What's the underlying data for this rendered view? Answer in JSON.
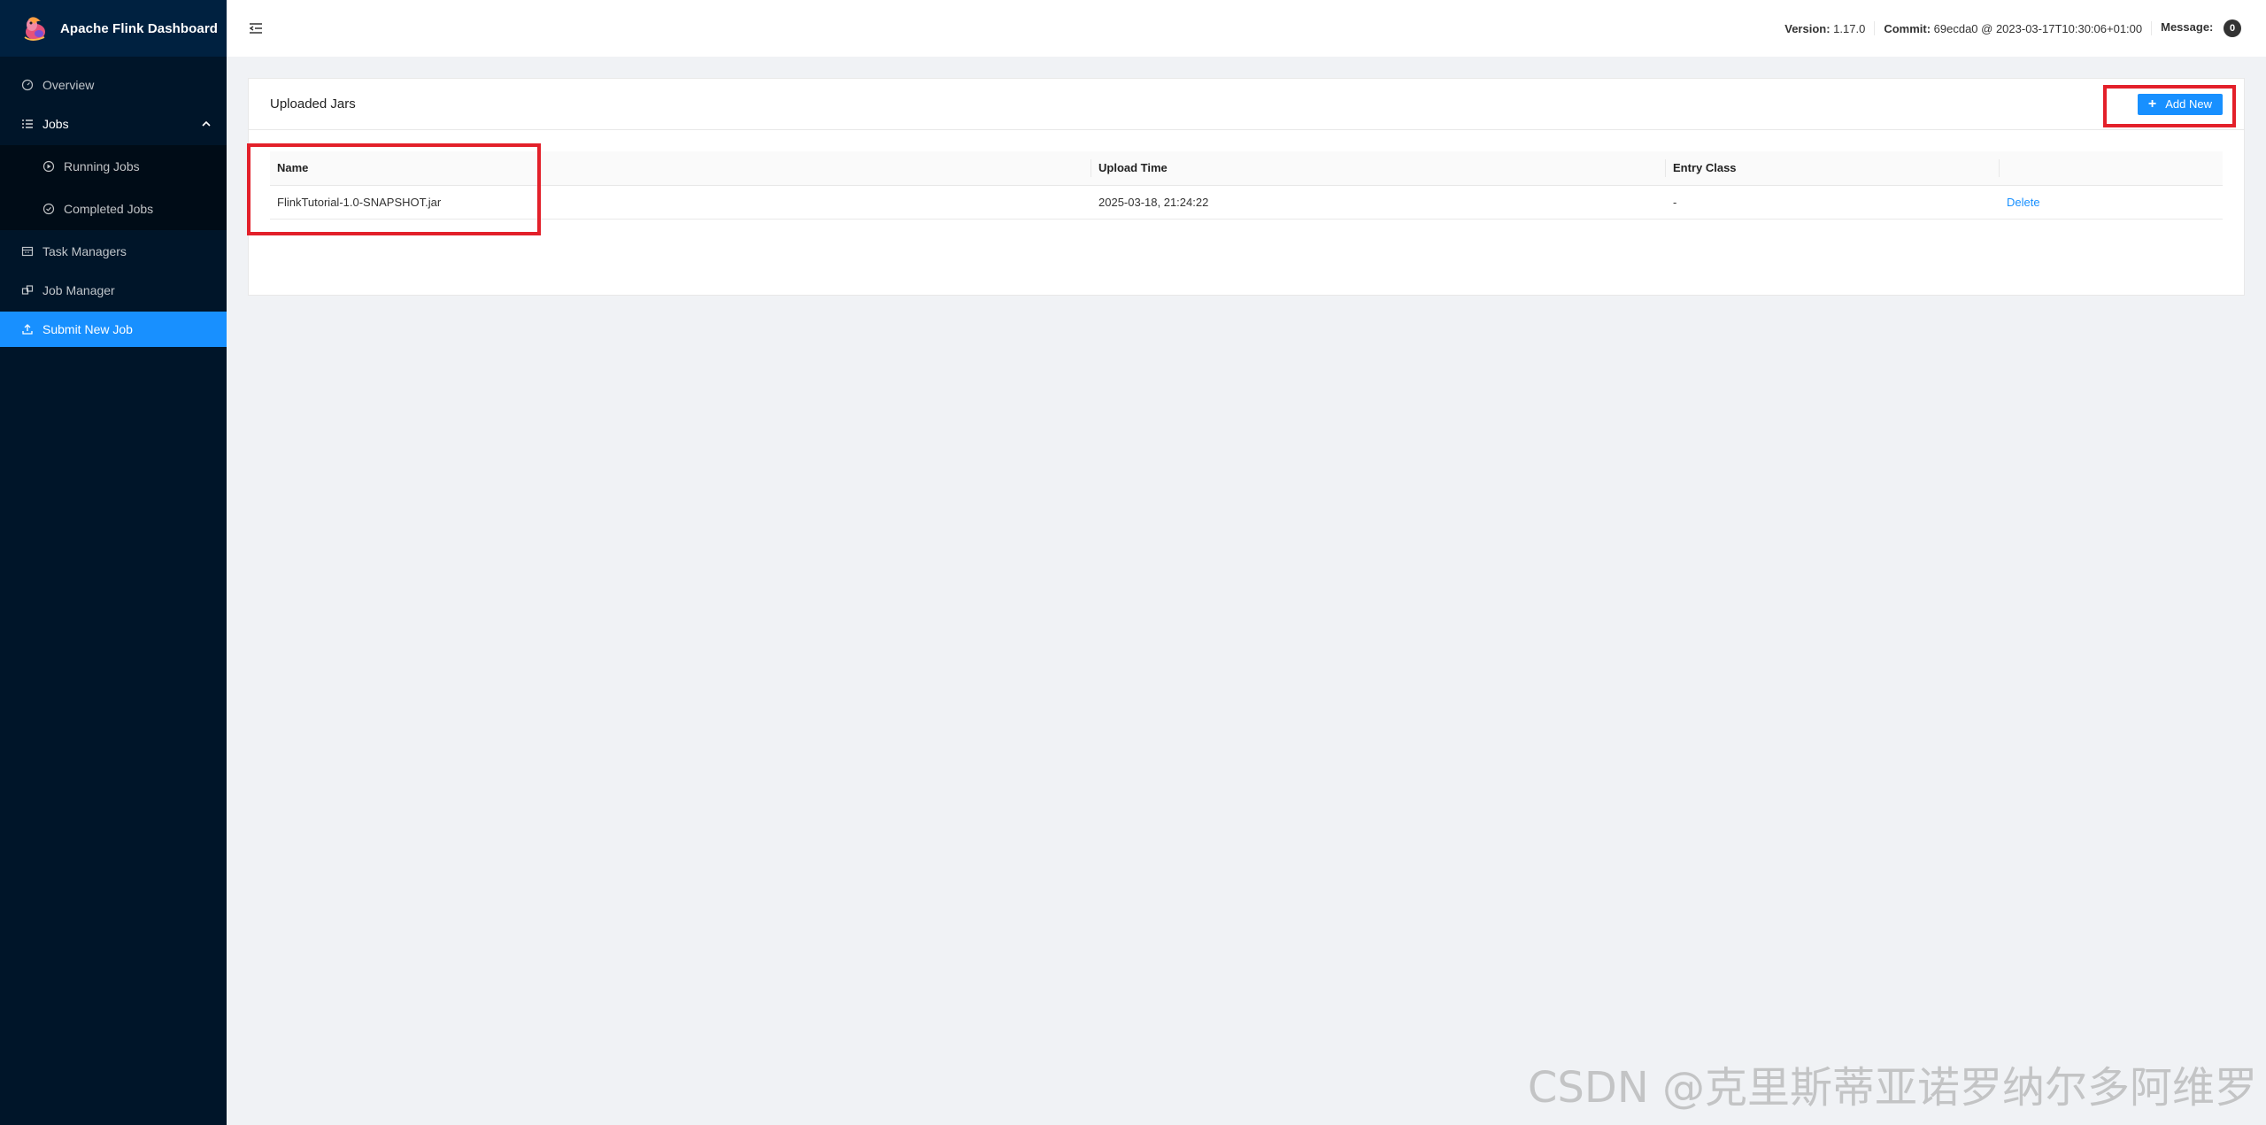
{
  "app": {
    "title": "Apache Flink Dashboard"
  },
  "sidebar": {
    "items": [
      {
        "label": "Overview",
        "icon": "dashboard-icon"
      },
      {
        "label": "Jobs",
        "icon": "list-icon"
      },
      {
        "label": "Running Jobs",
        "icon": "play-circle-icon"
      },
      {
        "label": "Completed Jobs",
        "icon": "check-circle-icon"
      },
      {
        "label": "Task Managers",
        "icon": "schedule-icon"
      },
      {
        "label": "Job Manager",
        "icon": "build-icon"
      },
      {
        "label": "Submit New Job",
        "icon": "upload-icon"
      }
    ],
    "active": "Submit New Job"
  },
  "header": {
    "version_label": "Version:",
    "version_value": "1.17.0",
    "commit_label": "Commit:",
    "commit_value": "69ecda0 @ 2023-03-17T10:30:06+01:00",
    "message_label": "Message:",
    "message_count": "0"
  },
  "card": {
    "title": "Uploaded Jars",
    "add_button": "Add New"
  },
  "table": {
    "columns": [
      "Name",
      "Upload Time",
      "Entry Class",
      ""
    ],
    "rows": [
      {
        "name": "FlinkTutorial-1.0-SNAPSHOT.jar",
        "upload_time": "2025-03-18, 21:24:22",
        "entry_class": "-",
        "action": "Delete"
      }
    ]
  },
  "watermark": "CSDN @克里斯蒂亚诺罗纳尔多阿维罗",
  "colors": {
    "primary": "#1890ff",
    "sidebar": "#001529",
    "highlight": "#e3202a"
  }
}
